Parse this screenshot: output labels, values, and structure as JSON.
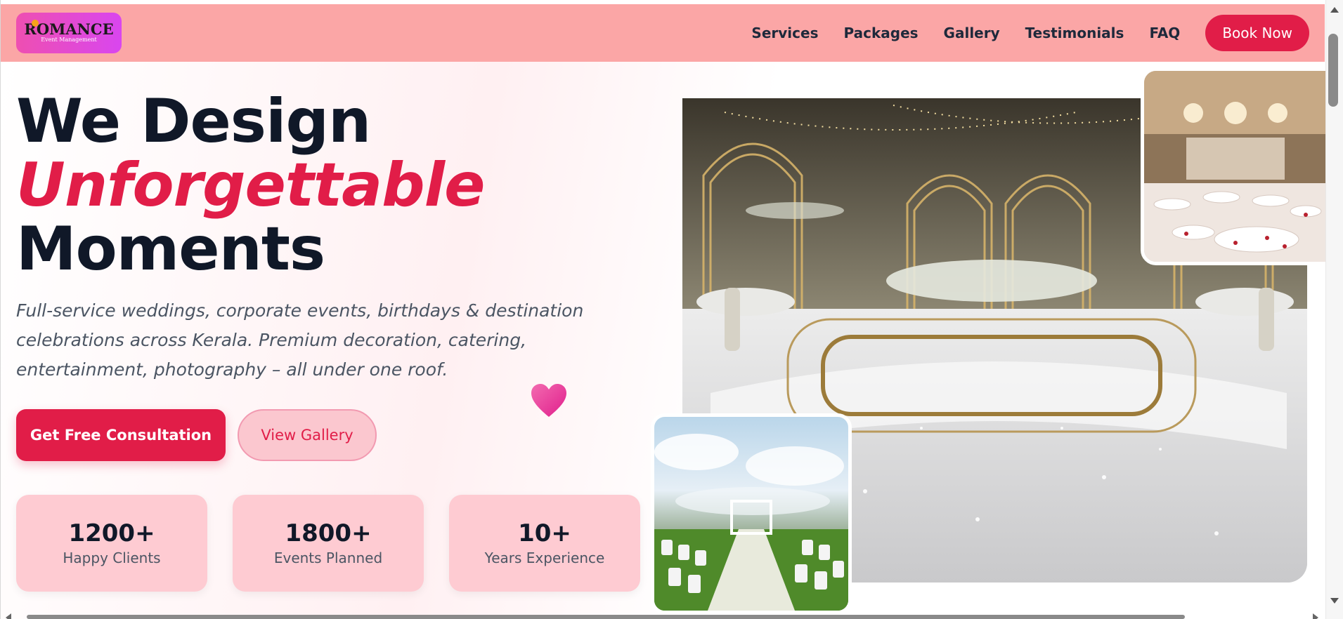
{
  "brand": {
    "logo_main": "ROMANCE",
    "logo_sub": "Event Management",
    "accent_color": "#e11d48",
    "nav_bg_color": "#fba6a6"
  },
  "nav": {
    "links": [
      "Services",
      "Packages",
      "Gallery",
      "Testimonials",
      "FAQ"
    ],
    "cta_label": "Book Now"
  },
  "hero": {
    "headline_line1": "We Design",
    "headline_accent": "Unforgettable",
    "headline_line3": "Moments",
    "tagline": "Full-service weddings, corporate events, birthdays & destination celebrations across Kerala. Premium decoration, catering, entertainment, photography – all under one roof.",
    "primary_cta": "Get Free Consultation",
    "secondary_cta": "View Gallery"
  },
  "stats": [
    {
      "value": "1200+",
      "label": "Happy Clients"
    },
    {
      "value": "1800+",
      "label": "Events Planned"
    },
    {
      "value": "10+",
      "label": "Years Experience"
    }
  ],
  "icons": {
    "heart": "heart-icon"
  }
}
